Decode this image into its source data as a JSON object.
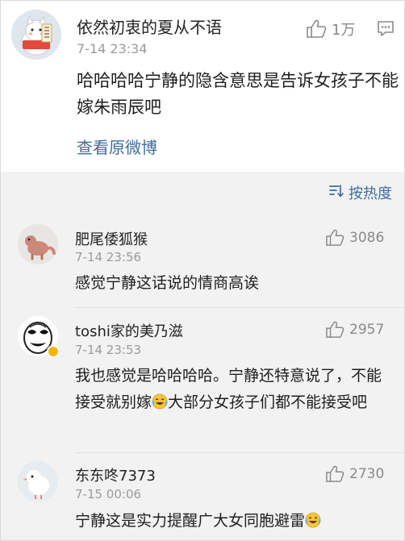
{
  "main_post": {
    "username": "依然初衷的夏从不语",
    "timestamp": "7-14 23:34",
    "like_count": "1万",
    "text": "哈哈哈哈宁静的隐含意思是告诉女孩子不能嫁朱雨辰吧",
    "view_original": "查看原微博",
    "avatar_icon": "cat-avatar-icon"
  },
  "sort": {
    "label": "按热度",
    "icon": "sort-icon"
  },
  "comments": [
    {
      "username": "肥尾倭狐猴",
      "timestamp": "7-14 23:56",
      "like_count": "3086",
      "text": "感觉宁静这话说的情商高诶",
      "avatar_icon": "lizard-avatar-icon"
    },
    {
      "username": "toshi家的美乃滋",
      "timestamp": "7-14 23:53",
      "like_count": "2957",
      "text_part1": "我也感觉是哈哈哈哈。宁静还特意说了，不能接受就别嫁",
      "text_part2": "大部分女孩子们都不能接受吧",
      "avatar_icon": "meme-face-avatar-icon",
      "verified": true
    },
    {
      "username": "东东咚7373",
      "timestamp": "7-15 00:06",
      "like_count": "2730",
      "text": "宁静这是实力提醒广大女同胞避雷",
      "avatar_icon": "bird-avatar-icon"
    }
  ],
  "colors": {
    "link": "#3e6ca0",
    "background": "#f2f2f2",
    "card": "#ffffff",
    "muted": "#9a9a9a",
    "badge": "#f6b500"
  }
}
